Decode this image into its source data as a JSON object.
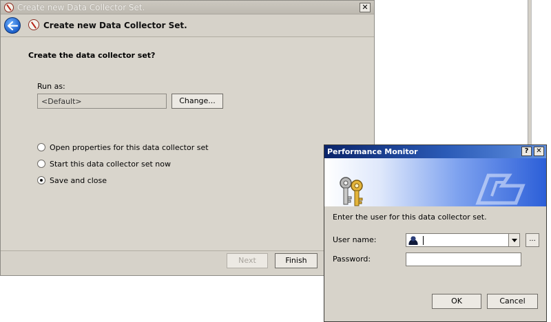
{
  "wizard": {
    "title": "Create new Data Collector Set.",
    "close_glyph": "✕",
    "header_title": "Create new Data Collector Set.",
    "heading": "Create the data collector set?",
    "run_as_label": "Run as:",
    "run_as_value": "<Default>",
    "change_button": "Change...",
    "options": [
      {
        "label": "Open properties for this data collector set",
        "selected": false
      },
      {
        "label": "Start this data collector set now",
        "selected": false
      },
      {
        "label": "Save and close",
        "selected": true
      }
    ],
    "buttons": {
      "next": "Next",
      "finish": "Finish"
    }
  },
  "dialog": {
    "title": "Performance Monitor",
    "help_glyph": "?",
    "close_glyph": "✕",
    "prompt": "Enter the user for this data collector set.",
    "user_name_label": "User name:",
    "password_label": "Password:",
    "browse_button": "...",
    "ok_button": "OK",
    "cancel_button": "Cancel"
  },
  "colors": {
    "window_bg": "#d6d2c9",
    "dialog_title_start": "#0a246a",
    "dialog_title_end": "#5f8fe0",
    "back_button": "#1d5fc9"
  },
  "icons": {
    "back": "back-arrow-icon",
    "app": "no-symbol-icon",
    "keys": "keys-icon",
    "user": "user-icon"
  }
}
